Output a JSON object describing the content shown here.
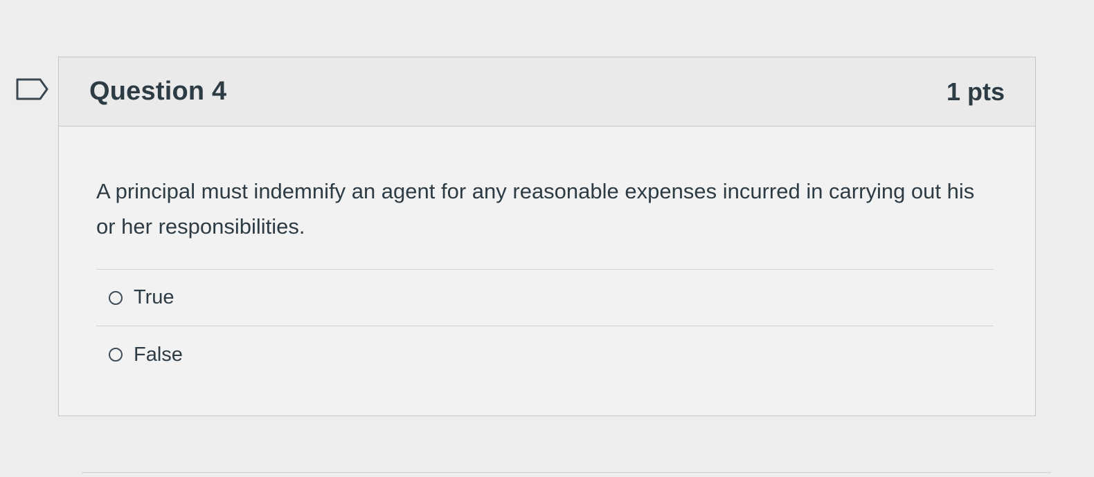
{
  "question": {
    "title": "Question 4",
    "points": "1 pts",
    "text": "A principal must indemnify an agent for any reasonable expenses incurred in carrying out his or her responsibilities.",
    "flag_icon": "bookmark-flag-icon",
    "answers": [
      {
        "label": "True",
        "selected": false
      },
      {
        "label": "False",
        "selected": false
      }
    ]
  },
  "colors": {
    "text": "#2d3b45",
    "border": "#c4c7ca",
    "header_bg": "#eaeaea",
    "card_bg": "#f2f2f2",
    "page_bg": "#ededed"
  }
}
